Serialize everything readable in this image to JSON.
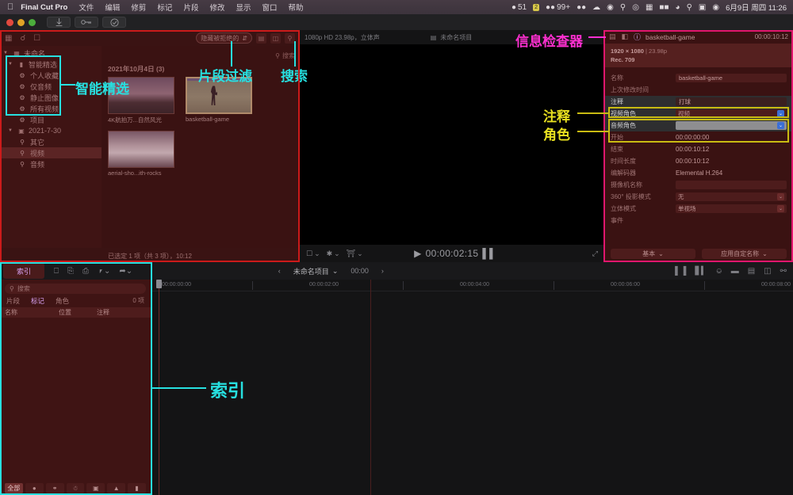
{
  "menubar": {
    "apple_icon": "apple-logo",
    "app_name": "Final Cut Pro",
    "items": [
      "文件",
      "编辑",
      "修剪",
      "标记",
      "片段",
      "修改",
      "显示",
      "窗口",
      "帮助"
    ],
    "status": {
      "drop_count": "51",
      "badge": "2",
      "message_count": "99+",
      "clock": "6月9日 周四 11:26"
    }
  },
  "window_toolbar": {
    "buttons": [
      "import-button",
      "keyframe-button",
      "check-button"
    ]
  },
  "browser": {
    "filter_popup": "隐藏被拒绝的",
    "search_placeholder": "搜索",
    "sidebar": {
      "library": "未命名",
      "smart_collections": "智能精选",
      "smart_items": [
        "个人收藏",
        "仅音频",
        "静止图像",
        "所有视频",
        "项目"
      ],
      "event": "2021-7-30",
      "keywords": [
        "其它",
        "视频",
        "音频"
      ],
      "selected_keyword": "视频"
    },
    "date_header": "2021年10月4日",
    "date_count": "(3)",
    "clips": [
      {
        "name": "4K航拍万...自然风光",
        "selected": false
      },
      {
        "name": "basketball-game",
        "selected": true
      },
      {
        "name": "aerial-sho...ith-rocks",
        "selected": false
      }
    ],
    "status": "已选定 1 项（共 3 项），10:12"
  },
  "viewer": {
    "format": "1080p HD 23.98p，立体声",
    "project": "未命名项目",
    "timecode": "00:00:02:15",
    "controls": [
      "crop-tool",
      "effects-tool",
      "color-tool"
    ]
  },
  "inspector": {
    "title": "basketball-game",
    "timecode": "00:00:10:12",
    "tabs": [
      "video-tab",
      "audio-tab",
      "info-tab"
    ],
    "active_tab": "info-tab",
    "summary_resolution": "1920 × 1080",
    "summary_fps": "| 23.98p",
    "summary_colorspace": "Rec. 709",
    "fields": [
      {
        "label": "名称",
        "value": "basketball-game",
        "kind": "field"
      },
      {
        "label": "上次修改时间",
        "value": "",
        "kind": "text"
      },
      {
        "label": "注释",
        "value": "打球",
        "kind": "highlight"
      },
      {
        "label": "视频角色",
        "value": "视频",
        "kind": "popup-blue"
      },
      {
        "label": "音频角色",
        "value": "",
        "kind": "popup-grey"
      },
      {
        "label": "开始",
        "value": "00:00:00:00",
        "kind": "text"
      },
      {
        "label": "结束",
        "value": "00:00:10:12",
        "kind": "text"
      },
      {
        "label": "时间长度",
        "value": "00:00:10:12",
        "kind": "text"
      },
      {
        "label": "编解码器",
        "value": "Elemental H.264",
        "kind": "text"
      },
      {
        "label": "摄像机名称",
        "value": "",
        "kind": "field"
      },
      {
        "label": "360° 投影模式",
        "value": "无",
        "kind": "popup"
      },
      {
        "label": "立体模式",
        "value": "单视场",
        "kind": "popup"
      },
      {
        "label": "事件",
        "value": "",
        "kind": "text"
      }
    ],
    "footer_buttons": [
      "基本",
      "应用自定名称"
    ]
  },
  "timeline_toolbar": {
    "index_label": "索引",
    "project": "未命名项目",
    "project_timecode": "00:00",
    "left_icons": [
      "append-icon",
      "insert-icon",
      "connect-icon",
      "overwrite-icon",
      "select-tool-icon"
    ],
    "right_icons": [
      "audio-skimming-icon",
      "waveform-icon",
      "solo-icon",
      "snapping-icon",
      "index-icon",
      "clip-appearance-icon",
      "fullscreen-timeline-icon"
    ]
  },
  "timeline_index": {
    "search_placeholder": "搜索",
    "tabs": [
      "片段",
      "标记",
      "角色"
    ],
    "active_tab": "标记",
    "count": "0 项",
    "columns": [
      "名称",
      "位置",
      "注释"
    ],
    "filters": [
      "全部",
      "待办事项-icon",
      "章节-icon",
      "分析-icon",
      "关键词-icon",
      "已完成-icon",
      "书签-icon"
    ],
    "active_filter": "全部"
  },
  "timeline": {
    "ruler_ticks": [
      "00:00:00:00",
      "00:00:02:00",
      "00:00:04:00",
      "00:00:06:00",
      "00:00:08:00"
    ]
  },
  "annotations": [
    {
      "id": "smart-collections",
      "text": "智能精选",
      "color": "#27e0e0"
    },
    {
      "id": "clip-filter",
      "text": "片段过滤",
      "color": "#27e0e0"
    },
    {
      "id": "search",
      "text": "搜索",
      "color": "#27e0e0"
    },
    {
      "id": "info-inspector",
      "text": "信息检查器",
      "color": "#ff2fd0"
    },
    {
      "id": "notes",
      "text": "注释",
      "color": "#e8e020"
    },
    {
      "id": "roles",
      "text": "角色",
      "color": "#e8e020"
    },
    {
      "id": "index",
      "text": "索引",
      "color": "#27e0e0"
    }
  ]
}
